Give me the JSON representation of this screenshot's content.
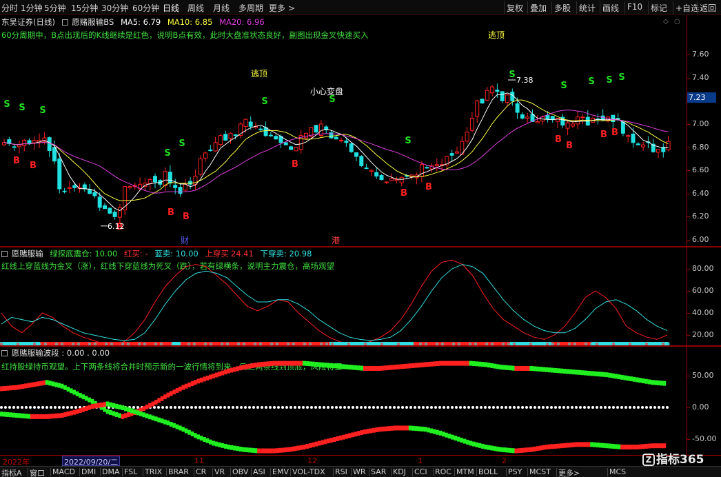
{
  "toolbar": {
    "periods": [
      "分时",
      "1分钟",
      "5分钟",
      "15分钟",
      "30分钟",
      "60分钟",
      "日线",
      "周线",
      "月线",
      "多周期",
      "更多 >"
    ],
    "active_period": "日线",
    "actions": [
      "复权",
      "叠加",
      "多股",
      "统计",
      "画线",
      "F10",
      "标记",
      "+自选",
      "返回"
    ]
  },
  "main_panel": {
    "stock": "东吴证券(日线)",
    "indicator": "愿赌服输BS",
    "ma5": "MA5: 6.79",
    "ma10": "MA10: 6.85",
    "ma20": "MA20: 6.96",
    "note": "60分周期中，B点出现后的K线继续是红色，说明B点有效，此时大盘准状态良好，副图出现金叉快速买入",
    "annotations": [
      "逃顶",
      "逃顶",
      "小心变盘"
    ],
    "high_label": "7.38",
    "low_label": "6.12",
    "event_marks": [
      "财",
      "港"
    ],
    "yticks": [
      "7.60",
      "7.40",
      "7.20",
      "7.00",
      "6.80",
      "6.60",
      "6.40",
      "6.20",
      "6.00"
    ],
    "current_price": "7.23",
    "colors": {
      "up": "#ff2020",
      "down": "#20e0e0",
      "ma5": "#ffffff",
      "ma10": "#ffff40",
      "ma20": "#e040e0"
    }
  },
  "osc_panel": {
    "name": "愿赌服输",
    "green_label": "绿探底震仓: 10.00",
    "red_buy": "红买: -",
    "blue_sell": "蓝卖: 10.00",
    "cross_up": "上穿买",
    "cross_up_val": "24.41",
    "cross_down": "下穿卖: 20.98",
    "note": "红线上穿蓝线为金叉（涨），红线下穿蓝线为死叉（跌），若有绿横条，说明主力震仓，高场观望",
    "yticks": [
      "80.00",
      "60.00",
      "40.00",
      "20.00"
    ]
  },
  "wave_panel": {
    "name": "愿赌服输波段",
    "values": ": 0.00 . 0.00",
    "note": "红持股绿持币观望。上下两条线将合并时预示新的一波行情将到来，反之两条线到顶底，风险将至",
    "yticks": [
      "50.00",
      "0.00",
      "-50.00"
    ]
  },
  "time_axis": {
    "year": "2022年",
    "cursor_date": "2022/09/20/二",
    "months": [
      "11",
      "12",
      "1",
      "2"
    ]
  },
  "indicator_tabs": [
    "指标A",
    "窗口",
    "MACD",
    "DMI",
    "DMA",
    "FSL",
    "TRIX",
    "BRAR",
    "CR",
    "VR",
    "OBV",
    "ASI",
    "EMV",
    "VOL-TDX",
    "RSI",
    "WR",
    "SAR",
    "KDJ",
    "CCI",
    "ROC",
    "MTM",
    "BOLL",
    "PSY",
    "MCST",
    "更多>",
    "MCS"
  ],
  "logo": "指标365",
  "chart_data": [
    {
      "type": "candlestick",
      "title": "东吴证券(日线) 愿赌服输BS",
      "ylim": [
        5.9,
        7.7
      ],
      "yticks": [
        6.0,
        6.2,
        6.4,
        6.6,
        6.8,
        7.0,
        7.2,
        7.4,
        7.6
      ],
      "closes": [
        6.84,
        6.83,
        6.8,
        6.82,
        6.86,
        6.83,
        6.86,
        6.86,
        6.88,
        6.77,
        6.68,
        6.44,
        6.42,
        6.45,
        6.45,
        6.45,
        6.44,
        6.4,
        6.38,
        6.28,
        6.27,
        6.23,
        6.2,
        6.28,
        6.46,
        6.46,
        6.47,
        6.48,
        6.49,
        6.52,
        6.5,
        6.48,
        6.59,
        6.49,
        6.45,
        6.4,
        6.48,
        6.48,
        6.55,
        6.7,
        6.75,
        6.77,
        6.84,
        6.9,
        6.86,
        6.92,
        6.9,
        7.0,
        7.04,
        6.98,
        6.98,
        6.95,
        6.9,
        6.9,
        6.87,
        6.84,
        6.82,
        6.78,
        6.8,
        6.9,
        6.92,
        6.97,
        6.93,
        7.0,
        6.95,
        6.88,
        6.87,
        6.86,
        6.84,
        6.76,
        6.72,
        6.64,
        6.62,
        6.6,
        6.55,
        6.52,
        6.5,
        6.53,
        6.52,
        6.54,
        6.55,
        6.56,
        6.56,
        6.65,
        6.62,
        6.64,
        6.65,
        6.65,
        6.72,
        6.73,
        6.76,
        6.85,
        6.93,
        7.05,
        7.2,
        7.18,
        7.29,
        7.32,
        7.28,
        7.2,
        7.25,
        7.2,
        7.1,
        7.05,
        7.06,
        7.02,
        7.02,
        7.06,
        7.04,
        7.04,
        7.05,
        6.99,
        7.01,
        7.0,
        7.06,
        7.06,
        6.99,
        7.05,
        7.04,
        7.04,
        7.06,
        7.02,
        7.04,
        6.92,
        6.9,
        6.84,
        6.82,
        6.82,
        6.84,
        6.76,
        6.78,
        6.76,
        6.85
      ],
      "high_marker": 7.38,
      "low_marker": 6.12,
      "signals_S": 13,
      "signals_B": 14
    },
    {
      "type": "line",
      "title": "愿赌服输",
      "ylim": [
        8,
        98
      ],
      "yticks": [
        20,
        40,
        60,
        80
      ],
      "series": [
        {
          "name": "红线",
          "values": [
            40,
            28,
            22,
            30,
            40,
            36,
            28,
            22,
            18,
            15,
            12,
            10,
            14,
            22,
            34,
            50,
            64,
            74,
            82,
            84,
            82,
            74,
            66,
            56,
            46,
            42,
            46,
            52,
            50,
            40,
            32,
            24,
            18,
            14,
            12,
            12,
            14,
            18,
            24,
            34,
            48,
            64,
            78,
            86,
            88,
            84,
            74,
            58,
            44,
            34,
            28,
            22,
            18,
            16,
            20,
            28,
            40,
            54,
            60,
            54,
            44,
            28,
            22,
            18,
            16,
            20
          ]
        },
        {
          "name": "蓝卖",
          "values": [
            30,
            36,
            34,
            32,
            36,
            34,
            30,
            26,
            22,
            20,
            18,
            16,
            15,
            16,
            22,
            34,
            48,
            60,
            70,
            76,
            78,
            76,
            72,
            64,
            56,
            50,
            50,
            52,
            52,
            48,
            42,
            34,
            28,
            22,
            18,
            16,
            15,
            16,
            18,
            24,
            34,
            46,
            60,
            72,
            80,
            84,
            82,
            76,
            64,
            52,
            42,
            34,
            28,
            24,
            22,
            22,
            26,
            34,
            44,
            50,
            52,
            48,
            42,
            34,
            28,
            24
          ]
        }
      ]
    },
    {
      "type": "line",
      "title": "愿赌服输波段",
      "ylim": [
        -80,
        90
      ],
      "yticks": [
        -50,
        0,
        50
      ],
      "series": [
        {
          "name": "上线",
          "values": [
            30,
            32,
            36,
            40,
            34,
            22,
            10,
            -6,
            -14,
            -6,
            6,
            20,
            32,
            42,
            50,
            58,
            64,
            68,
            70,
            70,
            70,
            68,
            66,
            64,
            62,
            62,
            64,
            66,
            68,
            70,
            70,
            70,
            68,
            64,
            62,
            62,
            60,
            58,
            56,
            54,
            52,
            48,
            44,
            40,
            38
          ]
        },
        {
          "name": "下线",
          "values": [
            -10,
            -12,
            -14,
            -14,
            -12,
            -6,
            2,
            6,
            0,
            -8,
            -16,
            -24,
            -34,
            -46,
            -56,
            -62,
            -66,
            -68,
            -68,
            -66,
            -62,
            -56,
            -50,
            -44,
            -38,
            -34,
            -32,
            -32,
            -34,
            -40,
            -48,
            -56,
            -62,
            -66,
            -68,
            -66,
            -62,
            -60,
            -58,
            -58,
            -60,
            -62,
            -62,
            -60,
            -60
          ]
        }
      ]
    }
  ]
}
